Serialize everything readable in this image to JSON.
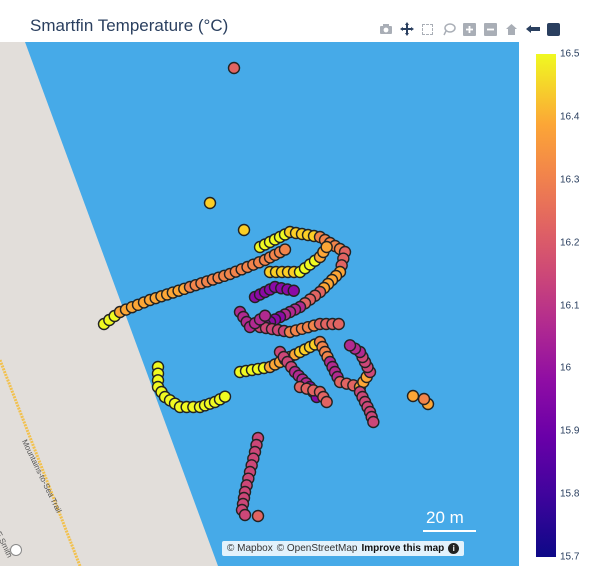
{
  "title": "Smartfin Temperature (°C)",
  "modebar": [
    {
      "name": "camera-icon",
      "glyph": "📷"
    },
    {
      "name": "pan-icon",
      "glyph": "✥"
    },
    {
      "name": "box-select-icon",
      "glyph": ""
    },
    {
      "name": "lasso-icon",
      "glyph": "◯"
    },
    {
      "name": "zoom-in-icon",
      "glyph": ""
    },
    {
      "name": "zoom-out-icon",
      "glyph": ""
    },
    {
      "name": "home-icon",
      "glyph": "⌂"
    },
    {
      "name": "toggle-icon",
      "glyph": "◂"
    },
    {
      "name": "plotly-logo-icon",
      "glyph": ""
    }
  ],
  "colorbar": {
    "min": 15.7,
    "max": 16.5,
    "ticks": [
      "16.5",
      "16.4",
      "16.3",
      "16.2",
      "16.1",
      "16",
      "15.9",
      "15.8",
      "15.7"
    ]
  },
  "colors": {
    "water": "#46aae8",
    "land": "#e2deda",
    "road": "#f2c14e"
  },
  "map_labels": {
    "road_name": "Mountains-to-Sea Trail",
    "corner_label": "E Smith"
  },
  "attribution": {
    "mapbox": "© Mapbox",
    "osm": "© OpenStreetMap",
    "improve": "Improve this map",
    "info": "i"
  },
  "scale_label": "20 m"
}
